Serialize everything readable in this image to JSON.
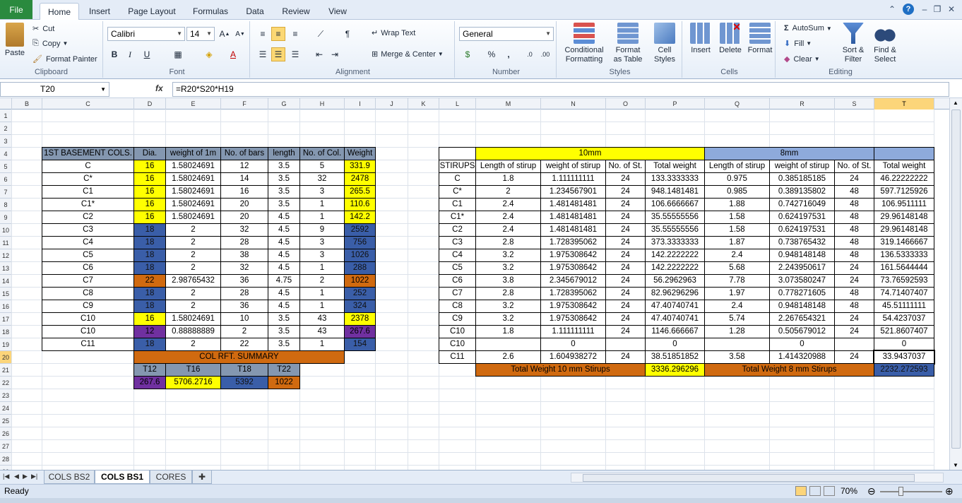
{
  "ribbon": {
    "tabs": [
      {
        "label": "File"
      },
      {
        "label": "Home"
      },
      {
        "label": "Insert"
      },
      {
        "label": "Page Layout"
      },
      {
        "label": "Formulas"
      },
      {
        "label": "Data"
      },
      {
        "label": "Review"
      },
      {
        "label": "View"
      }
    ],
    "clipboard": {
      "paste": "Paste",
      "cut": "Cut",
      "copy": "Copy",
      "format_painter": "Format Painter",
      "label": "Clipboard"
    },
    "font": {
      "name": "Calibri",
      "size": "14",
      "bold": "B",
      "italic": "I",
      "underline": "U",
      "label": "Font"
    },
    "alignment": {
      "wrap_text": "Wrap Text",
      "merge_center": "Merge & Center",
      "label": "Alignment"
    },
    "number": {
      "format": "General",
      "percent": "%",
      "comma": ",",
      "label": "Number"
    },
    "styles": {
      "conditional": [
        "Conditional",
        "Formatting"
      ],
      "format_table": [
        "Format",
        "as Table"
      ],
      "cell_styles": [
        "Cell",
        "Styles"
      ],
      "label": "Styles"
    },
    "cells": {
      "insert": "Insert",
      "delete": "Delete",
      "format": "Format",
      "label": "Cells"
    },
    "editing": {
      "autosum": "AutoSum",
      "fill": "Fill",
      "clear": "Clear",
      "sort_filter": [
        "Sort &",
        "Filter"
      ],
      "find_select": [
        "Find &",
        "Select"
      ],
      "label": "Editing"
    }
  },
  "formula_bar": {
    "name_box": "T20",
    "fx": "fx",
    "formula": "=R20*S20*H19"
  },
  "grid": {
    "columns": [
      "B",
      "C",
      "D",
      "E",
      "F",
      "G",
      "H",
      "I",
      "J",
      "K",
      "L",
      "M",
      "N",
      "O",
      "P",
      "Q",
      "R",
      "S",
      "T"
    ],
    "rows": [
      "1",
      "2",
      "3",
      "4",
      "5",
      "6",
      "7",
      "8",
      "9",
      "10",
      "11",
      "12",
      "13",
      "14",
      "15",
      "16",
      "17",
      "18",
      "19",
      "20",
      "21",
      "22",
      "23",
      "24",
      "25",
      "26",
      "27",
      "28",
      "29",
      "30",
      "31"
    ],
    "active_column": "T",
    "active_row": "20"
  },
  "table1": {
    "headers": [
      "1ST BASEMENT COLS.",
      "Dia.",
      "weight of 1m",
      "No. of bars",
      "length",
      "No. of Col.",
      "Weight"
    ],
    "rows": [
      [
        "C",
        "16",
        "1.58024691",
        "12",
        "3.5",
        "5",
        "331.9"
      ],
      [
        "C*",
        "16",
        "1.58024691",
        "14",
        "3.5",
        "32",
        "2478"
      ],
      [
        "C1",
        "16",
        "1.58024691",
        "16",
        "3.5",
        "3",
        "265.5"
      ],
      [
        "C1*",
        "16",
        "1.58024691",
        "20",
        "3.5",
        "1",
        "110.6"
      ],
      [
        "C2",
        "16",
        "1.58024691",
        "20",
        "4.5",
        "1",
        "142.2"
      ],
      [
        "C3",
        "18",
        "2",
        "32",
        "4.5",
        "9",
        "2592"
      ],
      [
        "C4",
        "18",
        "2",
        "28",
        "4.5",
        "3",
        "756"
      ],
      [
        "C5",
        "18",
        "2",
        "38",
        "4.5",
        "3",
        "1026"
      ],
      [
        "C6",
        "18",
        "2",
        "32",
        "4.5",
        "1",
        "288"
      ],
      [
        "C7",
        "22",
        "2.98765432",
        "36",
        "4.75",
        "2",
        "1022"
      ],
      [
        "C8",
        "18",
        "2",
        "28",
        "4.5",
        "1",
        "252"
      ],
      [
        "C9",
        "18",
        "2",
        "36",
        "4.5",
        "1",
        "324"
      ],
      [
        "C10",
        "16",
        "1.58024691",
        "10",
        "3.5",
        "43",
        "2378"
      ],
      [
        "C10",
        "12",
        "0.88888889",
        "2",
        "3.5",
        "43",
        "267.6"
      ],
      [
        "C11",
        "18",
        "2",
        "22",
        "3.5",
        "1",
        "154"
      ]
    ],
    "summary_title": "COL RFT. SUMMARY",
    "summary_headers": [
      "T12",
      "T16",
      "T18",
      "T22"
    ],
    "summary_values": [
      "267.6",
      "5706.2716",
      "5392",
      "1022"
    ]
  },
  "table2": {
    "group_10mm": "10mm",
    "group_8mm": "8mm",
    "headers": [
      "STIRUPS",
      "Length of stirup",
      "weight of stirup",
      "No. of St.",
      "Total weight",
      "Length of stirup",
      "weight of stirup",
      "No. of St.",
      "Total weight"
    ],
    "rows": [
      [
        "C",
        "1.8",
        "1.111111111",
        "24",
        "133.3333333",
        "0.975",
        "0.385185185",
        "24",
        "46.22222222"
      ],
      [
        "C*",
        "2",
        "1.234567901",
        "24",
        "948.1481481",
        "0.985",
        "0.389135802",
        "48",
        "597.7125926"
      ],
      [
        "C1",
        "2.4",
        "1.481481481",
        "24",
        "106.6666667",
        "1.88",
        "0.742716049",
        "48",
        "106.9511111"
      ],
      [
        "C1*",
        "2.4",
        "1.481481481",
        "24",
        "35.55555556",
        "1.58",
        "0.624197531",
        "48",
        "29.96148148"
      ],
      [
        "C2",
        "2.4",
        "1.481481481",
        "24",
        "35.55555556",
        "1.58",
        "0.624197531",
        "48",
        "29.96148148"
      ],
      [
        "C3",
        "2.8",
        "1.728395062",
        "24",
        "373.3333333",
        "1.87",
        "0.738765432",
        "48",
        "319.1466667"
      ],
      [
        "C4",
        "3.2",
        "1.975308642",
        "24",
        "142.2222222",
        "2.4",
        "0.948148148",
        "48",
        "136.5333333"
      ],
      [
        "C5",
        "3.2",
        "1.975308642",
        "24",
        "142.2222222",
        "5.68",
        "2.243950617",
        "24",
        "161.5644444"
      ],
      [
        "C6",
        "3.8",
        "2.345679012",
        "24",
        "56.2962963",
        "7.78",
        "3.073580247",
        "24",
        "73.76592593"
      ],
      [
        "C7",
        "2.8",
        "1.728395062",
        "24",
        "82.96296296",
        "1.97",
        "0.778271605",
        "48",
        "74.71407407"
      ],
      [
        "C8",
        "3.2",
        "1.975308642",
        "24",
        "47.40740741",
        "2.4",
        "0.948148148",
        "48",
        "45.51111111"
      ],
      [
        "C9",
        "3.2",
        "1.975308642",
        "24",
        "47.40740741",
        "5.74",
        "2.267654321",
        "24",
        "54.4237037"
      ],
      [
        "C10",
        "1.8",
        "1.111111111",
        "24",
        "1146.666667",
        "1.28",
        "0.505679012",
        "24",
        "521.8607407"
      ],
      [
        "C10",
        "",
        "0",
        "",
        "0",
        "",
        "0",
        "",
        "0"
      ],
      [
        "C11",
        "2.6",
        "1.604938272",
        "24",
        "38.51851852",
        "3.58",
        "1.414320988",
        "24",
        "33.9437037"
      ]
    ],
    "total_10_label": "Total Weight 10 mm Stirups",
    "total_10_value": "3336.296296",
    "total_8_label": "Total Weight 8 mm Stirups",
    "total_8_value": "2232.272593"
  },
  "sheets": {
    "tabs": [
      "COLS BS2",
      "COLS BS1",
      "CORES"
    ],
    "active": "COLS BS1"
  },
  "status": {
    "ready": "Ready",
    "zoom": "70%"
  },
  "colors": {
    "yellow": "#ffff00",
    "blue": "#3a5ea8",
    "orange": "#d06a10",
    "purple": "#7030a0",
    "header_gray": "#8497b0",
    "light_blue": "#8eaadb",
    "file_green": "#2a8a3e"
  }
}
